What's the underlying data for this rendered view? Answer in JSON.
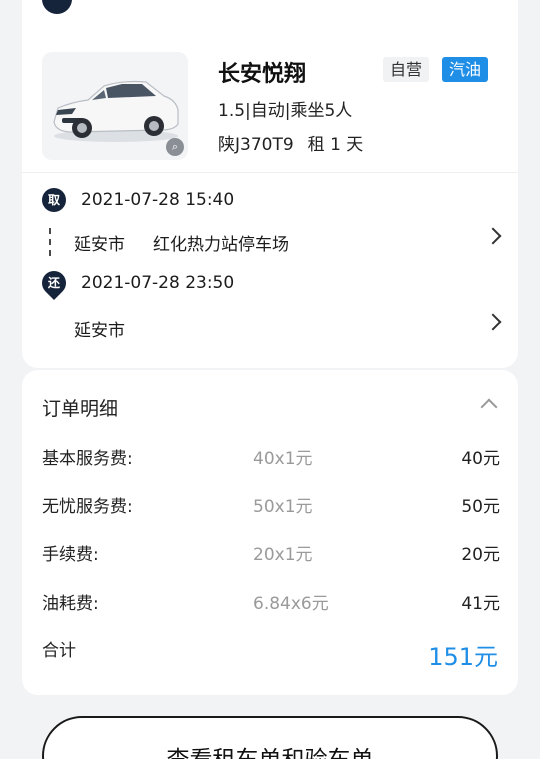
{
  "vehicle": {
    "name": "长安悦翔",
    "tag_self": "自营",
    "tag_fuel": "汽油",
    "spec": "1.5|自动|乘坐5人",
    "plate": "陕J370T9",
    "rent": "租 1 天"
  },
  "pickup": {
    "pin_label": "取",
    "time": "2021-07-28 15:40",
    "city": "延安市",
    "station": "红化热力站停车场"
  },
  "return": {
    "pin_label": "还",
    "time": "2021-07-28 23:50",
    "city": "延安市"
  },
  "order": {
    "title": "订单明细",
    "items": [
      {
        "label": "基本服务费:",
        "calc": "40x1元",
        "amount": "40元"
      },
      {
        "label": "无忧服务费:",
        "calc": "50x1元",
        "amount": "50元"
      },
      {
        "label": "手续费:",
        "calc": "20x1元",
        "amount": "20元"
      },
      {
        "label": "油耗费:",
        "calc": "6.84x6元",
        "amount": "41元"
      }
    ],
    "total_label": "合计",
    "total_amount": "151元"
  },
  "actions": {
    "view_button": "查看租车单和验车单"
  },
  "colors": {
    "accent": "#1f8ee6",
    "pin": "#15233b"
  },
  "icons": [
    "zoom-icon",
    "chevron-right-icon",
    "chevron-up-icon"
  ]
}
